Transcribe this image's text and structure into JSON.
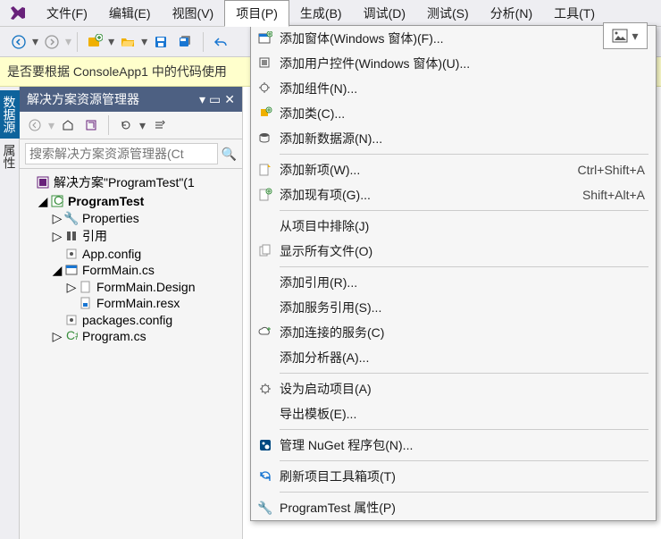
{
  "menu": {
    "file": "文件(F)",
    "edit": "编辑(E)",
    "view": "视图(V)",
    "project": "项目(P)",
    "build": "生成(B)",
    "debug": "调试(D)",
    "test": "测试(S)",
    "analyze": "分析(N)",
    "tools": "工具(T)"
  },
  "info_bar": "是否要根据 ConsoleApp1 中的代码使用",
  "left_tabs": {
    "data_source": "数据源",
    "properties": "属性"
  },
  "solution_explorer": {
    "title": "解决方案资源管理器",
    "search_placeholder": "搜索解决方案资源管理器(Ct",
    "solution_label": "解决方案\"ProgramTest\"(1 ",
    "project": "ProgramTest",
    "nodes": {
      "properties": "Properties",
      "references": "引用",
      "appconfig": "App.config",
      "formmain": "FormMain.cs",
      "formmain_designer": "FormMain.Design",
      "formmain_resx": "FormMain.resx",
      "packages": "packages.config",
      "program": "Program.cs"
    }
  },
  "ctx": {
    "add_winform": "添加窗体(Windows 窗体)(F)...",
    "add_usercontrol": "添加用户控件(Windows 窗体)(U)...",
    "add_component": "添加组件(N)...",
    "add_class": "添加类(C)...",
    "add_data_source": "添加新数据源(N)...",
    "add_new_item": "添加新项(W)...",
    "add_new_item_sc": "Ctrl+Shift+A",
    "add_existing_item": "添加现有项(G)...",
    "add_existing_item_sc": "Shift+Alt+A",
    "exclude": "从项目中排除(J)",
    "show_all": "显示所有文件(O)",
    "add_reference": "添加引用(R)...",
    "add_service_ref": "添加服务引用(S)...",
    "add_connected_service": "添加连接的服务(C)",
    "add_analyzer": "添加分析器(A)...",
    "set_startup": "设为启动项目(A)",
    "export_template": "导出模板(E)...",
    "manage_nuget": "管理 NuGet 程序包(N)...",
    "refresh_toolbox": "刷新项目工具箱项(T)",
    "project_props": "ProgramTest 属性(P)"
  }
}
